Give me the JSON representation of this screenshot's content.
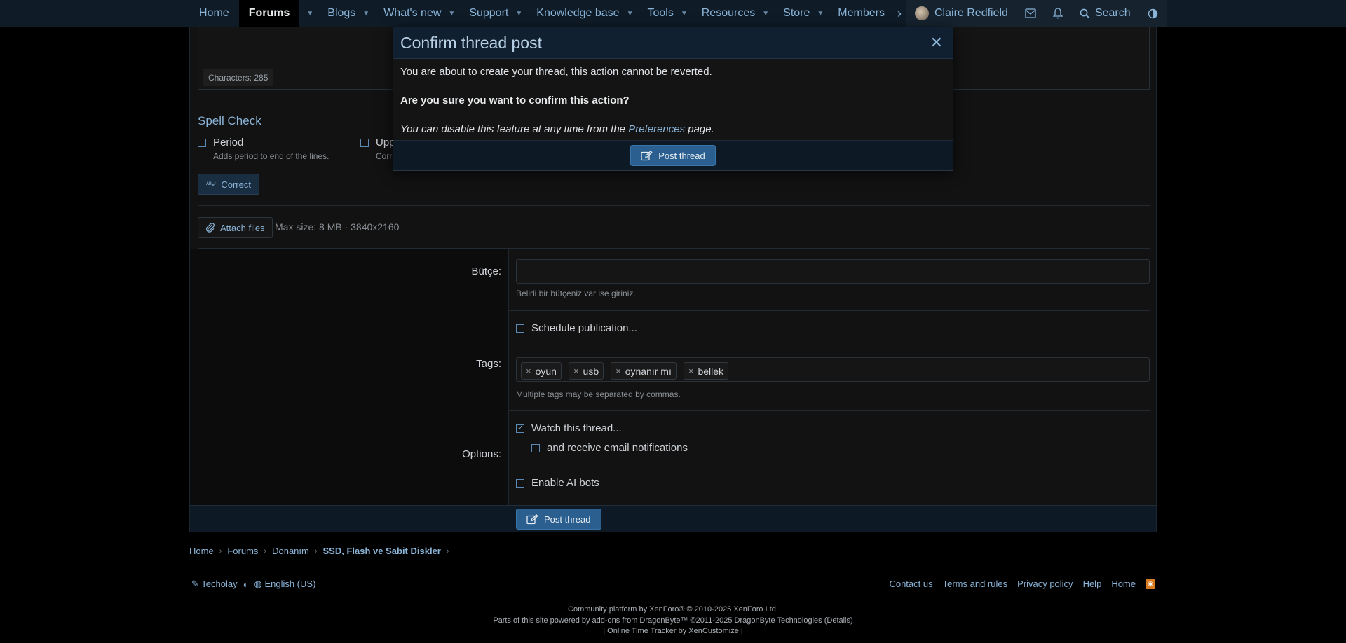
{
  "nav": {
    "items": [
      {
        "label": "Home",
        "has_caret": false
      },
      {
        "label": "Forums",
        "has_caret": true,
        "active": true
      },
      {
        "label": "Blogs",
        "has_caret": true
      },
      {
        "label": "What's new",
        "has_caret": true
      },
      {
        "label": "Support",
        "has_caret": true
      },
      {
        "label": "Knowledge base",
        "has_caret": true
      },
      {
        "label": "Tools",
        "has_caret": true
      },
      {
        "label": "Resources",
        "has_caret": true
      },
      {
        "label": "Store",
        "has_caret": true
      },
      {
        "label": "Members",
        "has_caret": false
      }
    ],
    "user": "Claire Redfield",
    "search": "Search"
  },
  "editor": {
    "char_count": "Characters: 285"
  },
  "spell_check": {
    "title": "Spell Check",
    "period_label": "Period",
    "period_desc": "Adds period to end of the lines.",
    "upper_label": "Upp",
    "upper_desc": "Corr",
    "correct_button": "Correct"
  },
  "attach": {
    "button": "Attach files",
    "info": "Max size: 8 MB · 3840x2160"
  },
  "form": {
    "budget_label": "Bütçe:",
    "budget_value": "",
    "budget_hint": "Belirli bir bütçeniz var ise giriniz.",
    "schedule_label": "Schedule publication...",
    "tags_label": "Tags:",
    "tags": [
      "oyun",
      "usb",
      "oynanır mı",
      "bellek"
    ],
    "tags_hint": "Multiple tags may be separated by commas.",
    "options_label": "Options:",
    "watch_label": "Watch this thread...",
    "email_label": "and receive email notifications",
    "ai_label": "Enable AI bots",
    "post_button": "Post thread"
  },
  "breadcrumb": [
    "Home",
    "Forums",
    "Donanım",
    "SSD, Flash ve Sabit Diskler"
  ],
  "footer": {
    "style": "Techolay",
    "language": "English (US)",
    "links": [
      "Contact us",
      "Terms and rules",
      "Privacy policy",
      "Help",
      "Home"
    ],
    "copyright_1": "Community platform by XenForo® © 2010-2025 XenForo Ltd.",
    "copyright_2": "Parts of this site powered by add-ons from DragonByte™ ©2011-2025 DragonByte Technologies (Details)",
    "copyright_3": "| Online Time Tracker by XenCustomize |"
  },
  "modal": {
    "title": "Confirm thread post",
    "line1": "You are about to create your thread, this action cannot be reverted.",
    "line2": "Are you sure you want to confirm this action?",
    "line3_pre": "You can disable this feature at any time from the ",
    "line3_link": "Preferences",
    "line3_post": " page.",
    "confirm_button": "Post thread"
  }
}
